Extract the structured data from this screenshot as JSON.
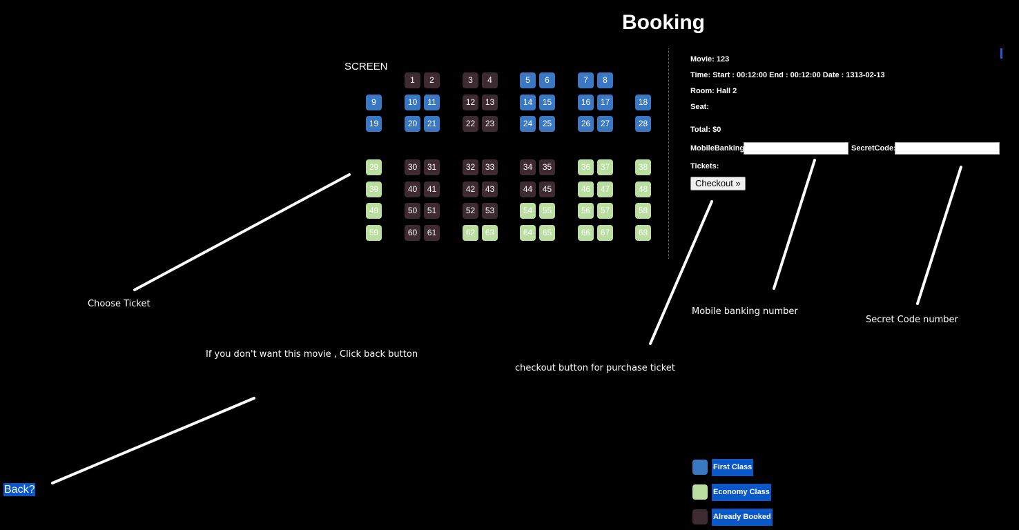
{
  "page": {
    "title": "Booking",
    "screen_label": "SCREEN"
  },
  "seats": {
    "rows": [
      [
        {
          "n": "1",
          "c": "booked"
        },
        {
          "n": "2",
          "c": "booked"
        },
        {
          "n": "3",
          "c": "booked"
        },
        {
          "n": "4",
          "c": "booked"
        },
        {
          "n": "5",
          "c": "first"
        },
        {
          "n": "6",
          "c": "first"
        },
        {
          "n": "7",
          "c": "first"
        },
        {
          "n": "8",
          "c": "first"
        }
      ],
      [
        {
          "n": "9",
          "c": "first"
        },
        {
          "n": "10",
          "c": "first"
        },
        {
          "n": "11",
          "c": "first"
        },
        {
          "n": "12",
          "c": "booked"
        },
        {
          "n": "13",
          "c": "booked"
        },
        {
          "n": "14",
          "c": "first"
        },
        {
          "n": "15",
          "c": "first"
        },
        {
          "n": "16",
          "c": "first"
        },
        {
          "n": "17",
          "c": "first"
        },
        {
          "n": "18",
          "c": "first"
        }
      ],
      [
        {
          "n": "19",
          "c": "first"
        },
        {
          "n": "20",
          "c": "first"
        },
        {
          "n": "21",
          "c": "first"
        },
        {
          "n": "22",
          "c": "booked"
        },
        {
          "n": "23",
          "c": "booked"
        },
        {
          "n": "24",
          "c": "first"
        },
        {
          "n": "25",
          "c": "first"
        },
        {
          "n": "26",
          "c": "first"
        },
        {
          "n": "27",
          "c": "first"
        },
        {
          "n": "28",
          "c": "first"
        }
      ],
      [
        {
          "n": "29",
          "c": "economy"
        },
        {
          "n": "30",
          "c": "booked"
        },
        {
          "n": "31",
          "c": "booked"
        },
        {
          "n": "32",
          "c": "booked"
        },
        {
          "n": "33",
          "c": "booked"
        },
        {
          "n": "34",
          "c": "booked"
        },
        {
          "n": "35",
          "c": "booked"
        },
        {
          "n": "36",
          "c": "economy"
        },
        {
          "n": "37",
          "c": "economy"
        },
        {
          "n": "38",
          "c": "economy"
        }
      ],
      [
        {
          "n": "39",
          "c": "economy"
        },
        {
          "n": "40",
          "c": "booked"
        },
        {
          "n": "41",
          "c": "booked"
        },
        {
          "n": "42",
          "c": "booked"
        },
        {
          "n": "43",
          "c": "booked"
        },
        {
          "n": "44",
          "c": "booked"
        },
        {
          "n": "45",
          "c": "booked"
        },
        {
          "n": "46",
          "c": "economy"
        },
        {
          "n": "47",
          "c": "economy"
        },
        {
          "n": "48",
          "c": "economy"
        }
      ],
      [
        {
          "n": "49",
          "c": "economy"
        },
        {
          "n": "50",
          "c": "booked"
        },
        {
          "n": "51",
          "c": "booked"
        },
        {
          "n": "52",
          "c": "booked"
        },
        {
          "n": "53",
          "c": "booked"
        },
        {
          "n": "54",
          "c": "economy"
        },
        {
          "n": "55",
          "c": "economy"
        },
        {
          "n": "56",
          "c": "economy"
        },
        {
          "n": "57",
          "c": "economy"
        },
        {
          "n": "58",
          "c": "economy"
        }
      ],
      [
        {
          "n": "59",
          "c": "economy"
        },
        {
          "n": "60",
          "c": "booked"
        },
        {
          "n": "61",
          "c": "booked"
        },
        {
          "n": "62",
          "c": "economy"
        },
        {
          "n": "63",
          "c": "economy"
        },
        {
          "n": "64",
          "c": "economy"
        },
        {
          "n": "65",
          "c": "economy"
        },
        {
          "n": "66",
          "c": "economy"
        },
        {
          "n": "67",
          "c": "economy"
        },
        {
          "n": "68",
          "c": "economy"
        }
      ]
    ]
  },
  "info": {
    "movie": "Movie: 123",
    "time": "Time: Start : 00:12:00 End : 00:12:00 Date : 1313-02-13",
    "room": "Room: Hall 2",
    "seat": "Seat:",
    "total": "Total: $0",
    "mobile_label": "MobileBanking:",
    "mobile_value": "",
    "secret_label": "SecretCode:",
    "secret_value": "",
    "tickets": "Tickets:",
    "checkout_label": "Checkout »"
  },
  "annotations": {
    "choose_ticket": "Choose Ticket",
    "back_hint": "If you don't want this movie , Click back button",
    "checkout_hint": "checkout button for purchase ticket",
    "mobile_hint": "Mobile banking number",
    "secret_hint": "Secret Code number"
  },
  "back": {
    "label": "Back?"
  },
  "legend": [
    {
      "label": "First Class",
      "color": "#3b78c4"
    },
    {
      "label": "Economy Class",
      "color": "#b9dea0"
    },
    {
      "label": "Already Booked",
      "color": "#3e2b31"
    }
  ],
  "colors": {
    "first": "#3b78c4",
    "economy": "#b9dea0",
    "booked": "#3e2b31",
    "accent": "#0a58c8"
  }
}
